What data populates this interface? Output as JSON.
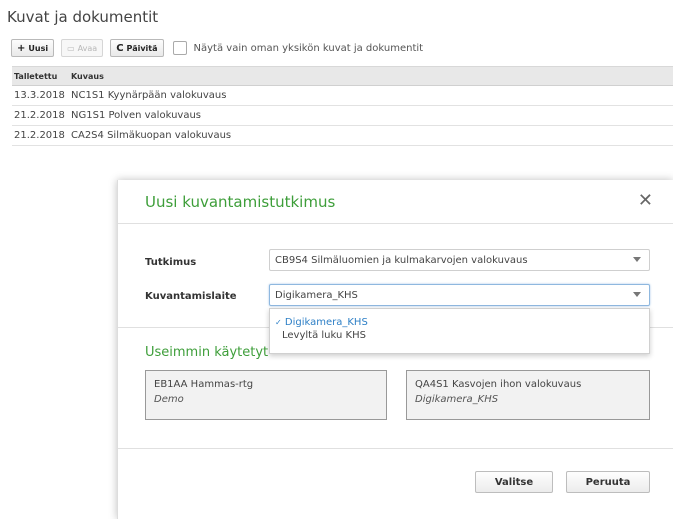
{
  "page": {
    "title": "Kuvat ja dokumentit"
  },
  "toolbar": {
    "new_label": "Uusi",
    "open_label": "Avaa",
    "refresh_label": "Päivitä",
    "own_unit_label": "Näytä vain oman yksikön kuvat ja dokumentit",
    "own_unit_checked": false
  },
  "grid": {
    "columns": [
      "Talletettu",
      "Kuvaus"
    ],
    "rows": [
      {
        "date": "13.3.2018",
        "desc": "NC1S1 Kyynärpään valokuvaus"
      },
      {
        "date": "21.2.2018",
        "desc": "NG1S1 Polven valokuvaus"
      },
      {
        "date": "21.2.2018",
        "desc": "CA2S4 Silmäkuopan valokuvaus"
      }
    ]
  },
  "modal": {
    "title": "Uusi kuvantamistutkimus",
    "close_icon": "close-icon",
    "tutkimus_label": "Tutkimus",
    "tutkimus_value": "CB9S4 Silmäluomien ja kulmakarvojen valokuvaus",
    "laite_label": "Kuvantamislaite",
    "laite_value": "Digikamera_KHS",
    "laite_options": [
      {
        "label": "Digikamera_KHS",
        "selected": true
      },
      {
        "label": "Levyltä luku KHS",
        "selected": false
      }
    ],
    "favorites_title": "Useimmin käytetyt",
    "favorites": [
      {
        "name": "EB1AA Hammas-rtg",
        "device": "Demo"
      },
      {
        "name": "QA4S1 Kasvojen ihon valokuvaus",
        "device": "Digikamera_KHS"
      }
    ],
    "select_button": "Valitse",
    "cancel_button": "Peruuta"
  },
  "colors": {
    "accent_green": "#3e9e3a",
    "selected_blue": "#2d7fc6"
  }
}
